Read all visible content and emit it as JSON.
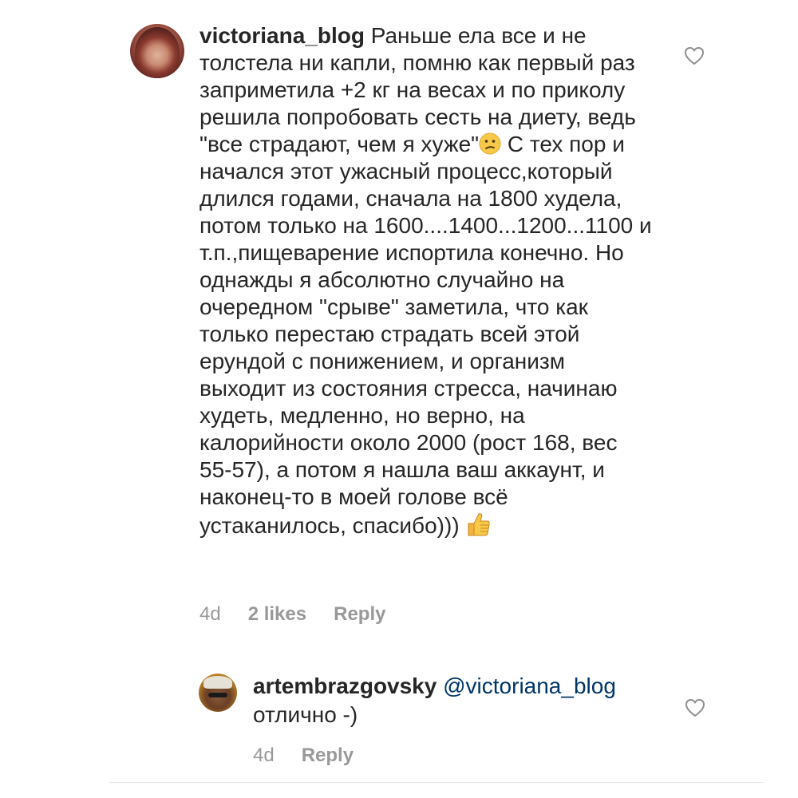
{
  "comments": [
    {
      "username": "victoriana_blog",
      "text_before_emoji": "Раньше ела все и не толстела ни капли, помню как первый раз заприметила +2 кг на весах и по приколу решила попробовать сесть на диету, ведь \"все страдают, чем я хуже\"",
      "emoji_1": "confused-face",
      "text_after_emoji": " С тех пор и начался этот ужасный процесс,который длился годами, сначала на 1800 худела, потом только на 1600....1400...1200...1100 и т.п.,пищеварение испортила конечно. Но однажды я абсолютно случайно на очередном \"срыве\" заметила, что как только перестаю страдать всей этой ерундой с понижением, и организм выходит из состояния стресса, начинаю худеть, медленно, но верно, на калорийности около 2000 (рост 168, вес 55-57), а потом я нашла ваш аккаунт, и наконец-то в моей голове всё устаканилось, спасибо))) ",
      "emoji_2": "thumbs-up",
      "time": "4d",
      "likes": "2 likes",
      "reply_label": "Reply"
    },
    {
      "username": "artembrazgovsky",
      "mention": "@victoriana_blog",
      "text": "отлично -)",
      "time": "4d",
      "reply_label": "Reply"
    }
  ],
  "colors": {
    "text": "#262626",
    "meta": "#999999",
    "mention": "#003569",
    "heart_stroke": "#8e8e8e"
  }
}
